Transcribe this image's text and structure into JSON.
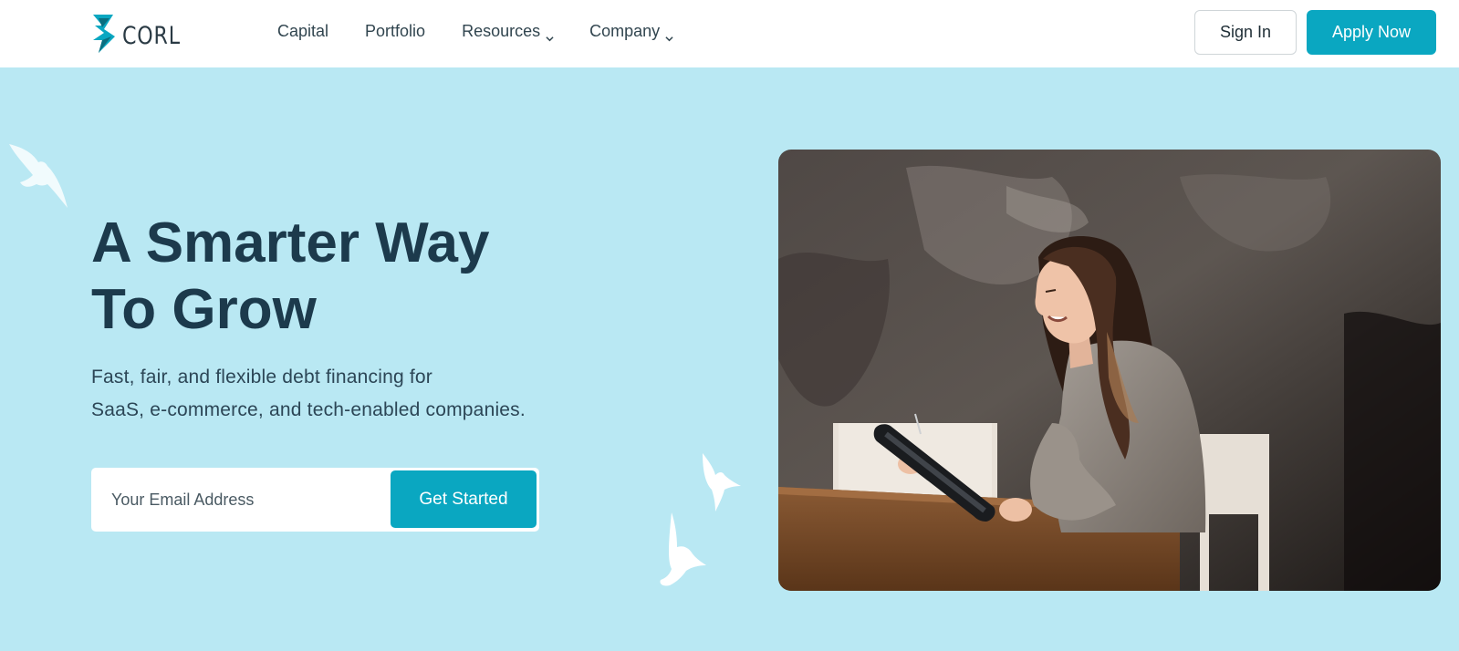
{
  "header": {
    "logo_text": "CORL",
    "nav": [
      {
        "label": "Capital",
        "has_dropdown": false
      },
      {
        "label": "Portfolio",
        "has_dropdown": false
      },
      {
        "label": "Resources",
        "has_dropdown": true
      },
      {
        "label": "Company",
        "has_dropdown": true
      }
    ],
    "sign_in_label": "Sign In",
    "apply_label": "Apply Now"
  },
  "hero": {
    "title_line1": "A Smarter Way",
    "title_line2": "To Grow",
    "subtitle_line1": "Fast, fair, and flexible debt financing for",
    "subtitle_line2": "SaaS, e-commerce, and tech-enabled companies.",
    "email_placeholder": "Your Email Address",
    "email_value": "",
    "cta_label": "Get Started"
  },
  "icons": {
    "logo": "corl-logo-icon",
    "dropdown": "chevron-down-icon",
    "birds": "bird-icon"
  },
  "colors": {
    "hero_background": "#b9e8f3",
    "accent": "#0aa7c1",
    "heading": "#1c3a4c"
  }
}
